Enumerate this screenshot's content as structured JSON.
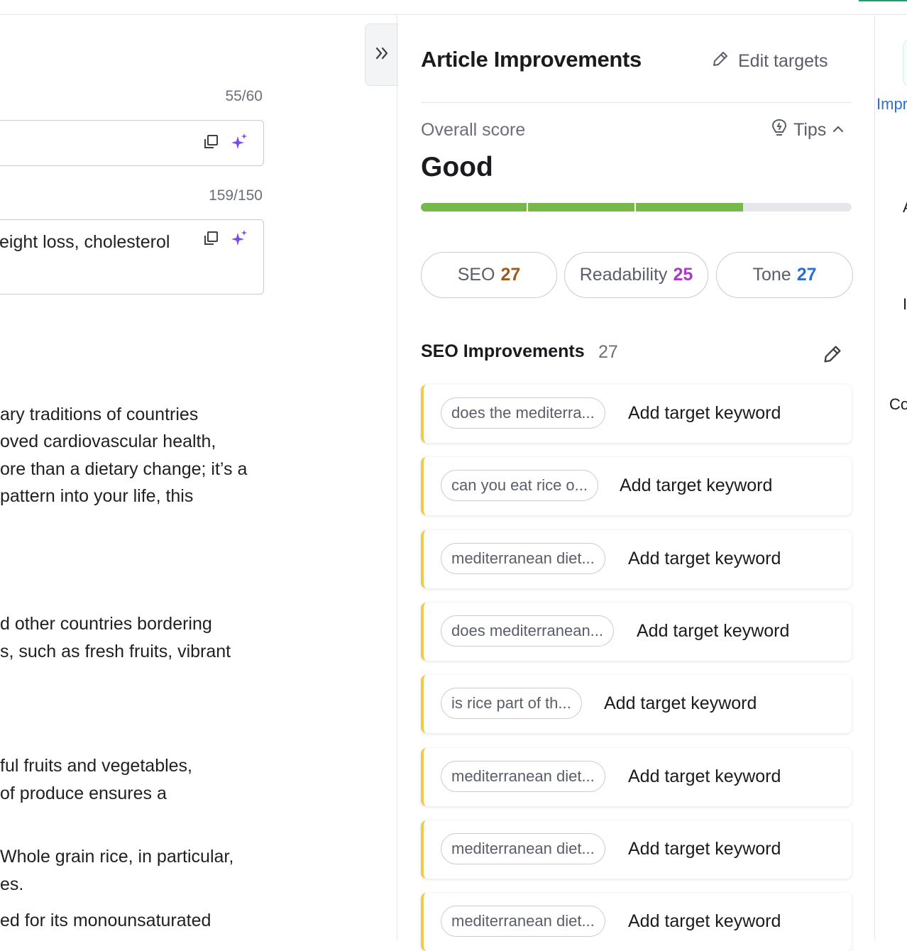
{
  "editor": {
    "title_counter": "55/60",
    "desc_counter": "159/150",
    "desc_text": "eight loss, cholesterol",
    "paragraphs": [
      "ary traditions of countries",
      "oved cardiovascular health,",
      "ore than a dietary change; it’s a",
      " pattern into your life, this",
      "d other countries bordering",
      "s, such as fresh fruits, vibrant",
      "ful fruits and vegetables,",
      "of produce ensures a",
      " Whole grain rice, in particular,",
      "es.",
      "ed for its monounsaturated"
    ]
  },
  "panel": {
    "title": "Article Improvements",
    "edit_targets": "Edit targets",
    "overall_label": "Overall score",
    "tips": "Tips",
    "overall_value": "Good",
    "score_progress": 0.75,
    "pills": [
      {
        "label": "SEO",
        "value": "27",
        "color": "#a05a1c"
      },
      {
        "label": "Readability",
        "value": "25",
        "color": "#a63cc4"
      },
      {
        "label": "Tone",
        "value": "27",
        "color": "#2d6fd1"
      }
    ],
    "section_title": "SEO Improvements",
    "section_count": "27",
    "cards": [
      {
        "chip": "does the mediterra...",
        "action": "Add target keyword"
      },
      {
        "chip": "can you eat rice o...",
        "action": "Add target keyword"
      },
      {
        "chip": "mediterranean diet...",
        "action": "Add target keyword"
      },
      {
        "chip": "does mediterranean...",
        "action": "Add target keyword"
      },
      {
        "chip": "is rice part of th...",
        "action": "Add target keyword"
      },
      {
        "chip": "mediterranean diet...",
        "action": "Add target keyword"
      },
      {
        "chip": "mediterranean diet...",
        "action": "Add target keyword"
      },
      {
        "chip": "mediterranean diet...",
        "action": "Add target keyword"
      }
    ]
  },
  "rightcol": {
    "impr_label": "Impr",
    "letter_a": "A",
    "letter_i": "I",
    "letter_co": "Co"
  },
  "colors": {
    "accent_green": "#77b84a",
    "card_border": "#f2c94c",
    "link_blue": "#2d6fd1",
    "ai_purple": "#7b4de0"
  }
}
